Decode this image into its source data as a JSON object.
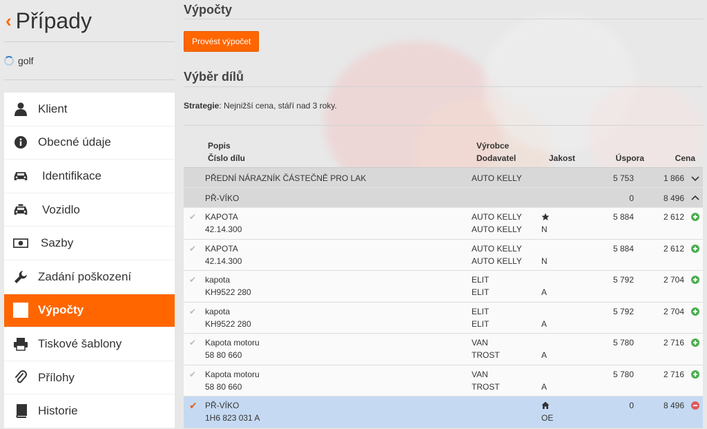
{
  "sidebar": {
    "title": "Případy",
    "case_name": "golf",
    "items": [
      {
        "label": "Klient",
        "icon": "user-icon",
        "active": false
      },
      {
        "label": "Obecné údaje",
        "icon": "info-icon",
        "active": false
      },
      {
        "label": "Identifikace",
        "icon": "car-icon",
        "active": false
      },
      {
        "label": "Vozidlo",
        "icon": "taxi-icon",
        "active": false
      },
      {
        "label": "Sazby",
        "icon": "money-icon",
        "active": false
      },
      {
        "label": "Zadání poškození",
        "icon": "wrench-icon",
        "active": false
      },
      {
        "label": "Výpočty",
        "icon": "calculator-icon",
        "active": true
      },
      {
        "label": "Tiskové šablony",
        "icon": "print-icon",
        "active": false
      },
      {
        "label": "Přílohy",
        "icon": "paperclip-icon",
        "active": false
      },
      {
        "label": "Historie",
        "icon": "book-icon",
        "active": false
      }
    ]
  },
  "main": {
    "title": "Výpočty",
    "calc_button": "Provést výpočet",
    "section_title": "Výběr dílů",
    "strategy_label": "Strategie",
    "strategy_text": ": Nejnižší cena, stáří nad 3 roky.",
    "columns": {
      "desc1": "Popis",
      "desc2": "Číslo dílu",
      "mfr1": "Výrobce",
      "mfr2": "Dodavatel",
      "quality": "Jakost",
      "saving": "Úspora",
      "price": "Cena"
    },
    "groups": [
      {
        "name": "PŘEDNÍ NÁRAZNÍK ČÁSTEČNĚ PRO LAK",
        "supplier": "AUTO KELLY",
        "saving": "5 753",
        "price": "1 866",
        "expanded": false
      },
      {
        "name": "PŘ-VÍKO",
        "supplier": "",
        "saving": "0",
        "price": "8 496",
        "expanded": true
      }
    ],
    "rows": [
      {
        "desc": "KAPOTA",
        "part": "42.14.300",
        "mfr": "AUTO KELLY",
        "supplier": "AUTO KELLY",
        "q_icon": "star-icon",
        "quality": "N",
        "saving": "5 884",
        "price": "2 612",
        "selected": false
      },
      {
        "desc": "KAPOTA",
        "part": "42.14.300",
        "mfr": "AUTO KELLY",
        "supplier": "AUTO KELLY",
        "q_icon": "",
        "quality": "N",
        "saving": "5 884",
        "price": "2 612",
        "selected": false
      },
      {
        "desc": "kapota",
        "part": "KH9522 280",
        "mfr": "ELIT",
        "supplier": "ELIT",
        "q_icon": "",
        "quality": "A",
        "saving": "5 792",
        "price": "2 704",
        "selected": false
      },
      {
        "desc": "kapota",
        "part": "KH9522 280",
        "mfr": "ELIT",
        "supplier": "ELIT",
        "q_icon": "",
        "quality": "A",
        "saving": "5 792",
        "price": "2 704",
        "selected": false
      },
      {
        "desc": "Kapota motoru",
        "part": "58 80 660",
        "mfr": "VAN",
        "supplier": "TROST",
        "q_icon": "",
        "quality": "A",
        "saving": "5 780",
        "price": "2 716",
        "selected": false
      },
      {
        "desc": "Kapota motoru",
        "part": "58 80 660",
        "mfr": "VAN",
        "supplier": "TROST",
        "q_icon": "",
        "quality": "A",
        "saving": "5 780",
        "price": "2 716",
        "selected": false
      },
      {
        "desc": "PŘ-VÍKO",
        "part": "1H6 823 031 A",
        "mfr": "",
        "supplier": "",
        "q_icon": "home-icon",
        "quality": "OE",
        "saving": "0",
        "price": "8 496",
        "selected": true
      }
    ],
    "check_icon": "✔",
    "colors": {
      "accent": "#ff6600",
      "selected_row": "#c5daf2",
      "add": "#4caf50",
      "remove": "#e05a5a"
    }
  }
}
